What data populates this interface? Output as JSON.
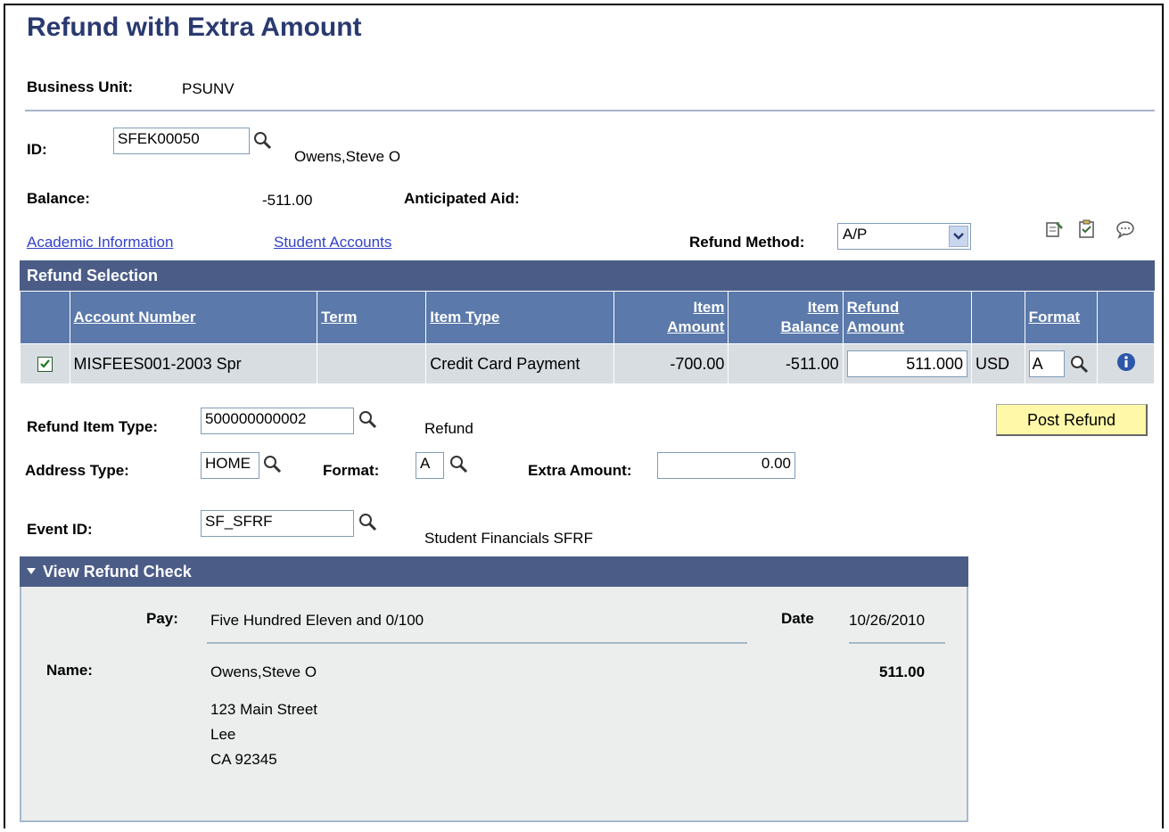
{
  "page": {
    "title": "Refund with Extra Amount"
  },
  "business_unit": {
    "label": "Business Unit:",
    "value": "PSUNV"
  },
  "id_field": {
    "label": "ID:",
    "value": "SFEK00050",
    "name": "Owens,Steve O"
  },
  "balance": {
    "label": "Balance:",
    "value": "-511.00"
  },
  "anticipated_aid": {
    "label": "Anticipated Aid:"
  },
  "links": {
    "academic": "Academic Information",
    "accounts": "Student Accounts"
  },
  "refund_method": {
    "label": "Refund Method:",
    "value": "A/P"
  },
  "icons": [
    "notepad-icon",
    "checklist-icon",
    "comment-icon",
    "search-icon",
    "info-icon"
  ],
  "grid": {
    "title": "Refund Selection",
    "headers": {
      "account": "Account Number",
      "term": "Term",
      "item_type": "Item Type",
      "item_amount_1": "Item",
      "item_amount_2": "Amount",
      "item_balance_1": "Item",
      "item_balance_2": "Balance",
      "refund_amount_1": "Refund",
      "refund_amount_2": "Amount",
      "format": "Format"
    },
    "row": {
      "checked": true,
      "account": "MISFEES001-2003 Spr",
      "term": "",
      "item_type": "Credit Card Payment",
      "item_amount": "-700.00",
      "item_balance": "-511.00",
      "refund_amount": "511.000",
      "currency": "USD",
      "format": "A"
    }
  },
  "refund_item_type": {
    "label": "Refund Item Type:",
    "value": "500000000002",
    "description": "Refund"
  },
  "post_refund": {
    "label": "Post Refund"
  },
  "address_type": {
    "label": "Address Type:",
    "value": "HOME"
  },
  "format_field": {
    "label": "Format:",
    "value": "A"
  },
  "extra_amount": {
    "label": "Extra Amount:",
    "value": "0.00"
  },
  "event_id": {
    "label": "Event ID:",
    "value": "SF_SFRF",
    "description": "Student Financials SFRF"
  },
  "check": {
    "title": "View Refund Check",
    "pay_label": "Pay:",
    "pay_value": "Five Hundred Eleven and 0/100",
    "date_label": "Date",
    "date_value": "10/26/2010",
    "name_label": "Name:",
    "name_value": "Owens,Steve O",
    "amount": "511.00",
    "address_line1": "123 Main Street",
    "address_line2": "Lee",
    "address_line3": "CA 92345"
  },
  "colors": {
    "header_bar": "#4b5d87",
    "grid_header": "#5b79aa",
    "title": "#2a3a70",
    "link": "#3342c8",
    "button": "#fff8a8"
  }
}
